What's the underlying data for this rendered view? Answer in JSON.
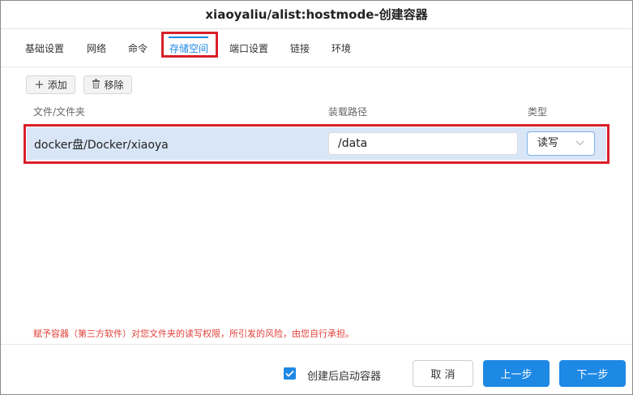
{
  "title": "xiaoyaliu/alist:hostmode-创建容器",
  "tabs": [
    {
      "label": "基础设置",
      "active": false
    },
    {
      "label": "网络",
      "active": false
    },
    {
      "label": "命令",
      "active": false
    },
    {
      "label": "存储空间",
      "active": true
    },
    {
      "label": "端口设置",
      "active": false
    },
    {
      "label": "链接",
      "active": false
    },
    {
      "label": "环境",
      "active": false
    }
  ],
  "toolbar": {
    "add_label": "添加",
    "remove_label": "移除"
  },
  "table": {
    "headers": {
      "path": "文件/文件夹",
      "mount": "装载路径",
      "type": "类型"
    },
    "rows": [
      {
        "path": "docker盘/Docker/xiaoya",
        "mount": "/data",
        "type": "读写"
      }
    ]
  },
  "warning": "赋予容器（第三方软件）对您文件夹的读写权限，所引发的风险，由您自行承担。",
  "footer": {
    "checkbox_label": "创建后启动容器",
    "checkbox_checked": true,
    "cancel_label": "取 消",
    "prev_label": "上一步",
    "next_label": "下一步"
  },
  "colors": {
    "accent": "#1e88e5",
    "highlight": "#d9202a",
    "row_bg": "#d8e6f7",
    "warning": "#e0413a"
  }
}
